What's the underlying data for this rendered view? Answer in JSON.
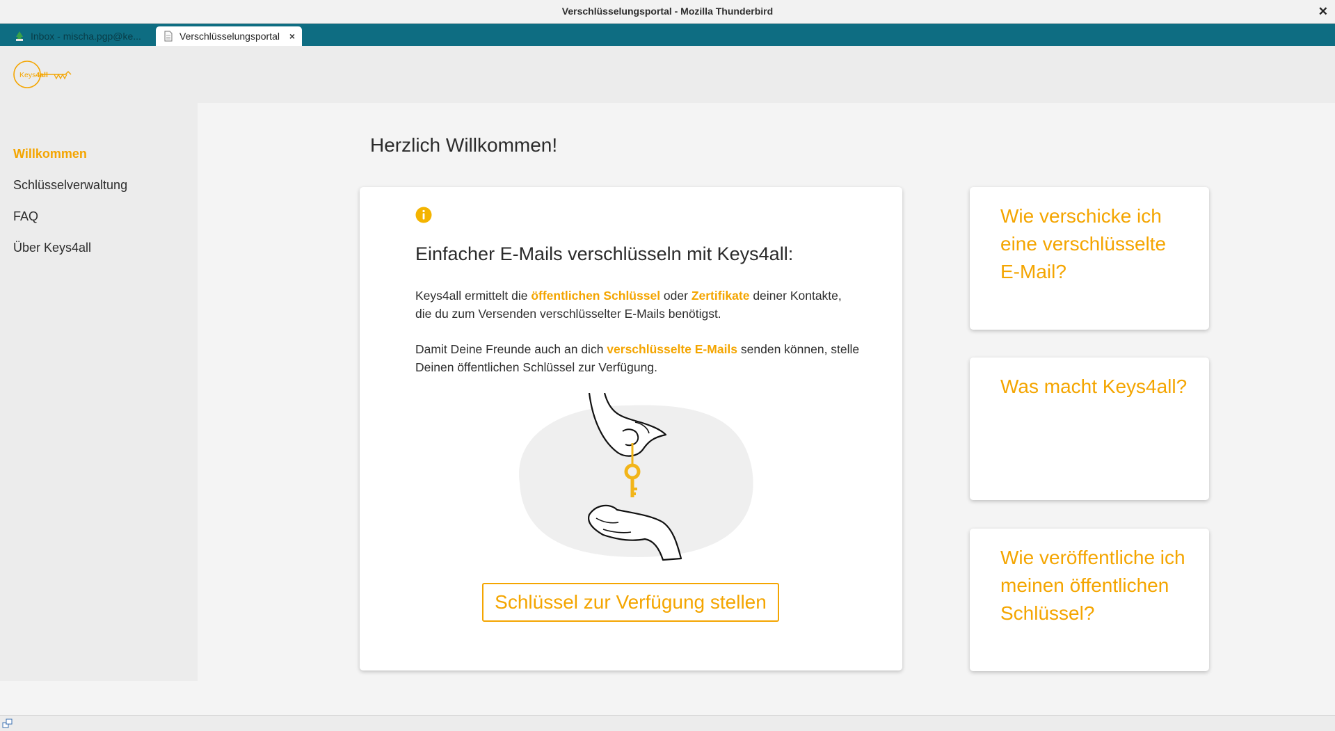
{
  "window": {
    "title": "Verschlüsselungsportal - Mozilla Thunderbird",
    "close_glyph": "✕"
  },
  "tabs": [
    {
      "label": "Inbox - mischa.pgp@ke...",
      "icon": "thunderbird-icon",
      "active": false
    },
    {
      "label": "Verschlüsselungsportal",
      "icon": "document-icon",
      "active": true,
      "close_glyph": "×"
    }
  ],
  "logo": {
    "text_a": "Keys",
    "text_b": "4all",
    "color": "#f4a500"
  },
  "sidebar": {
    "items": [
      {
        "label": "Willkommen",
        "active": true
      },
      {
        "label": "Schlüsselverwaltung",
        "active": false
      },
      {
        "label": "FAQ",
        "active": false
      },
      {
        "label": "Über Keys4all",
        "active": false
      }
    ]
  },
  "main": {
    "title": "Herzlich Willkommen!",
    "card": {
      "info_icon": "info-icon",
      "heading": "Einfacher E-Mails verschlüsseln mit Keys4all:",
      "para1": {
        "t1": "Keys4all ermittelt die ",
        "h1": "öffentlichen Schlüssel",
        "t2": " oder ",
        "h2": "Zertifikate",
        "t3": " deiner Kontakte, die du zum Versenden verschlüsselter E-Mails benötigst."
      },
      "para2": {
        "t1": "Damit Deine Freunde auch an dich ",
        "h1": "verschlüsselte E-Mails",
        "t2": " senden können, stelle Deinen öffentlichen Schlüssel zur Verfügung."
      },
      "illustration": "hands-passing-key-illustration",
      "cta_label": "Schlüssel zur Verfügung stellen"
    },
    "faq_cards": [
      {
        "question": "Wie verschicke ich eine verschlüsselte E-Mail?"
      },
      {
        "question": "Was macht Keys4all?"
      },
      {
        "question": "Wie veröffentliche ich meinen öffentlichen Schlüssel?"
      }
    ]
  },
  "colors": {
    "accent": "#f4a500",
    "tabbar": "#0e6d82",
    "sidebar_bg": "#ececec",
    "content_bg": "#f4f4f4"
  }
}
